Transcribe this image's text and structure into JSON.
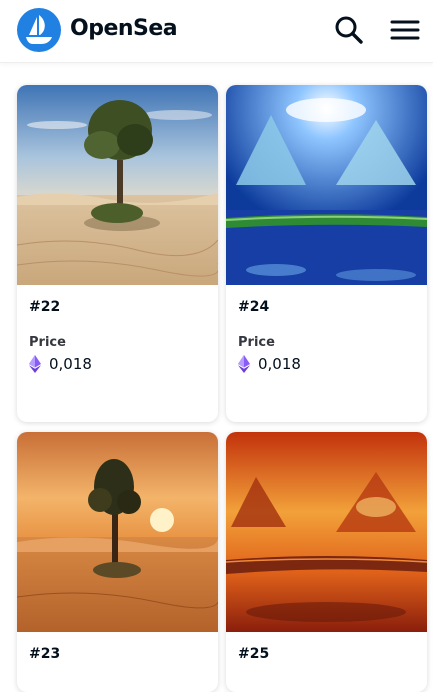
{
  "header": {
    "brand": "OpenSea",
    "icons": {
      "logo": "opensea-logo-icon",
      "search": "search-icon",
      "menu": "hamburger-menu-icon"
    },
    "brand_color": "#2081e2"
  },
  "price_label": "Price",
  "currency_icon": "ethereum-icon",
  "currency_color": "#8a5cf6",
  "cards": [
    {
      "title": "#22",
      "price": "0,018",
      "image": "tree in sand desert under blue sky"
    },
    {
      "title": "#24",
      "price": "0,018",
      "image": "blue sky with glowing mountains and green band"
    },
    {
      "title": "#23",
      "price": "",
      "image": "tree in orange desert at sunset"
    },
    {
      "title": "#25",
      "price": "",
      "image": "fiery orange sky with mountain shapes"
    }
  ]
}
